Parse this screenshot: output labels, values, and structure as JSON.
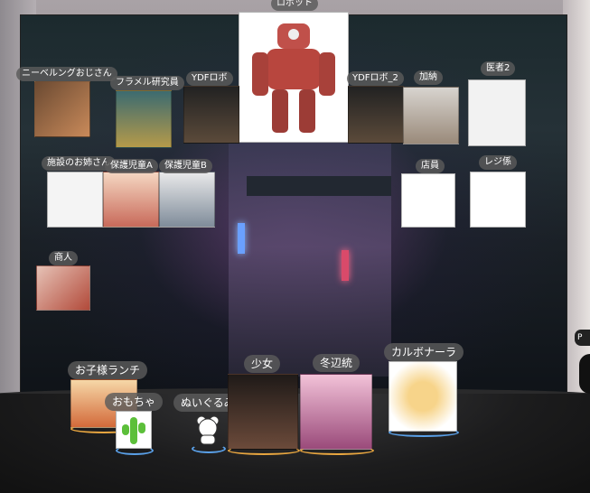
{
  "avatars": [
    {
      "label": "ロボット"
    },
    {
      "label": "ニーベルングおじさん"
    },
    {
      "label": "フラメル研究員"
    },
    {
      "label": "YDFロボ"
    },
    {
      "label": "YDFロボ_2"
    },
    {
      "label": "加納"
    },
    {
      "label": "医者2"
    },
    {
      "label": "施設のお姉さん"
    },
    {
      "label": "保護児童A"
    },
    {
      "label": "保護児童B"
    },
    {
      "label": "店員"
    },
    {
      "label": "レジ係"
    },
    {
      "label": "商人"
    }
  ],
  "props": [
    {
      "label": "お子様ランチ"
    },
    {
      "label": "おもちゃ"
    },
    {
      "label": "ぬいぐるみ"
    },
    {
      "label": "少女"
    },
    {
      "label": "冬辺統"
    },
    {
      "label": "カルボナーラ"
    }
  ],
  "side_badge": "P"
}
